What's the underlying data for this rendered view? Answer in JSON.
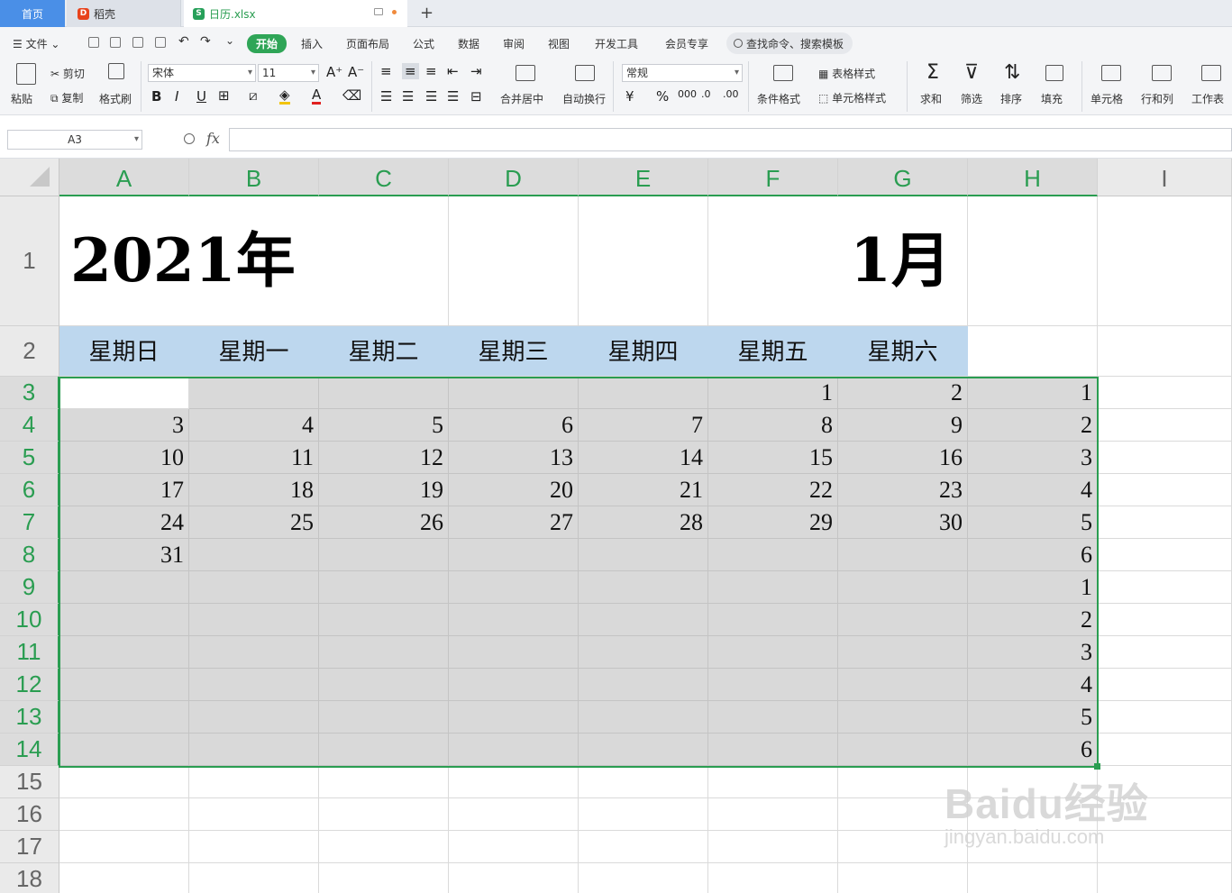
{
  "tabs": {
    "home": "首页",
    "daoke": "稻壳",
    "file": "日历.xlsx"
  },
  "menu": {
    "file": "文件",
    "items": [
      "开始",
      "插入",
      "页面布局",
      "公式",
      "数据",
      "审阅",
      "视图",
      "开发工具",
      "会员专享"
    ],
    "search_placeholder": "查找命令、搜索模板"
  },
  "ribbon": {
    "paste": "粘贴",
    "cut": "剪切",
    "copy": "复制",
    "format_painter": "格式刷",
    "font_name": "宋体",
    "font_size": "11",
    "number_format": "常规",
    "merge_center": "合并居中",
    "wrap_text": "自动换行",
    "conditional_format": "条件格式",
    "table_style": "表格样式",
    "cell_style": "单元格样式",
    "sum": "求和",
    "filter": "筛选",
    "sort": "排序",
    "fill": "填充",
    "cell": "单元格",
    "row_col": "行和列",
    "worksheet": "工作表"
  },
  "formula_bar": {
    "name_box": "A3",
    "fx": "fx",
    "content": ""
  },
  "sheet": {
    "columns": [
      "A",
      "B",
      "C",
      "D",
      "E",
      "F",
      "G",
      "H",
      "I"
    ],
    "rows": [
      "1",
      "2",
      "3",
      "4",
      "5",
      "6",
      "7",
      "8",
      "9",
      "10",
      "11",
      "12",
      "13",
      "14",
      "15",
      "16",
      "17",
      "18"
    ],
    "year_title": "2021年",
    "month_title": "1月",
    "weekdays": [
      "星期日",
      "星期一",
      "星期二",
      "星期三",
      "星期四",
      "星期五",
      "星期六"
    ],
    "calendar": [
      [
        "",
        "",
        "",
        "",
        "",
        "1",
        "2",
        "1"
      ],
      [
        "3",
        "4",
        "5",
        "6",
        "7",
        "8",
        "9",
        "2"
      ],
      [
        "10",
        "11",
        "12",
        "13",
        "14",
        "15",
        "16",
        "3"
      ],
      [
        "17",
        "18",
        "19",
        "20",
        "21",
        "22",
        "23",
        "4"
      ],
      [
        "24",
        "25",
        "26",
        "27",
        "28",
        "29",
        "30",
        "5"
      ],
      [
        "31",
        "",
        "",
        "",
        "",
        "",
        "",
        "6"
      ],
      [
        "",
        "",
        "",
        "",
        "",
        "",
        "",
        "1"
      ],
      [
        "",
        "",
        "",
        "",
        "",
        "",
        "",
        "2"
      ],
      [
        "",
        "",
        "",
        "",
        "",
        "",
        "",
        "3"
      ],
      [
        "",
        "",
        "",
        "",
        "",
        "",
        "",
        "4"
      ],
      [
        "",
        "",
        "",
        "",
        "",
        "",
        "",
        "5"
      ],
      [
        "",
        "",
        "",
        "",
        "",
        "",
        "",
        "6"
      ]
    ]
  },
  "watermark": {
    "line1": "Baidu经验",
    "line2": "jingyan.baidu.com"
  },
  "colors": {
    "accent_green": "#2a9d51",
    "weekday_header": "#bdd7ee",
    "selection_fill": "#d9d9d9",
    "home_tab": "#4a8fe7"
  }
}
